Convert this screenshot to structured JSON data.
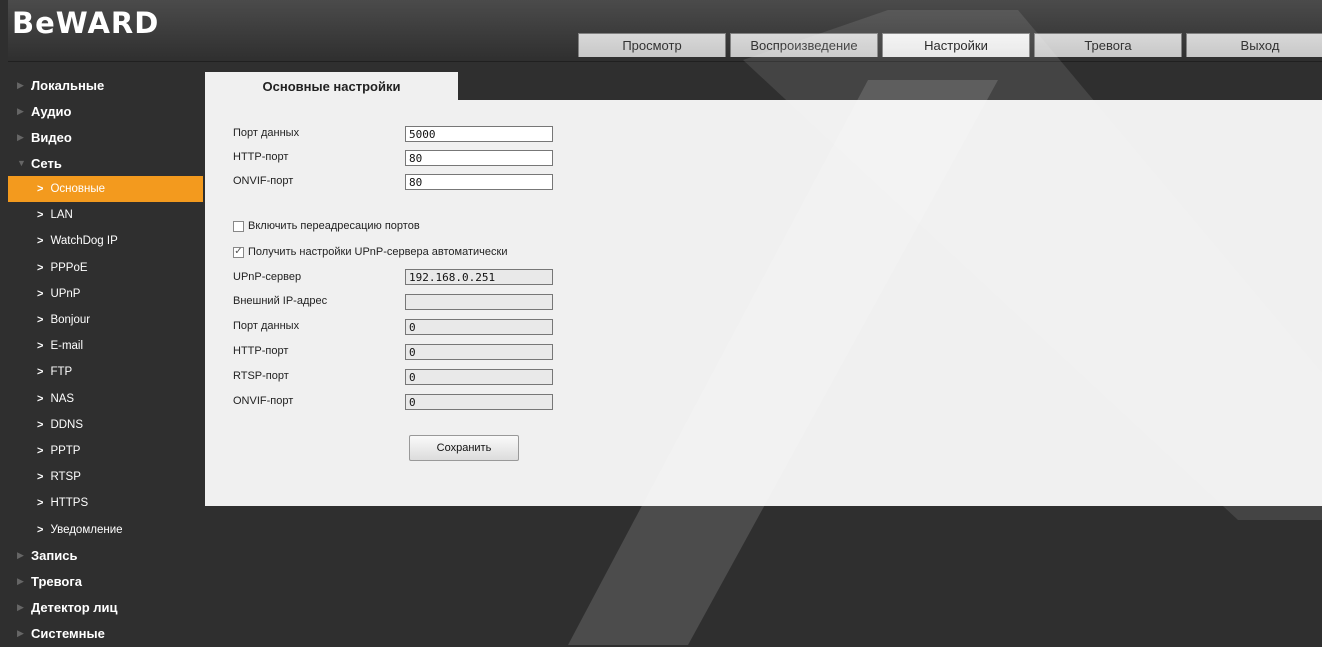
{
  "brand": {
    "logo_text": "BeWARD"
  },
  "nav": {
    "tabs": [
      {
        "label": "Просмотр",
        "active": false
      },
      {
        "label": "Воспроизведение",
        "active": false
      },
      {
        "label": "Настройки",
        "active": true
      },
      {
        "label": "Тревога",
        "active": false
      },
      {
        "label": "Выход",
        "active": false
      }
    ]
  },
  "sidebar": {
    "sections_top": [
      "Локальные",
      "Аудио",
      "Видео",
      "Сеть"
    ],
    "network_items": [
      "Основные",
      "LAN",
      "WatchDog IP",
      "PPPoE",
      "UPnP",
      "Bonjour",
      "E-mail",
      "FTP",
      "NAS",
      "DDNS",
      "PPTP",
      "RTSP",
      "HTTPS",
      "Уведомление"
    ],
    "sections_bottom": [
      "Запись",
      "Тревога",
      "Детектор лиц",
      "Системные"
    ],
    "active_item": "Основные"
  },
  "content": {
    "tab_title": "Основные настройки",
    "fields_top": [
      {
        "label": "Порт данных",
        "value": "5000"
      },
      {
        "label": "HTTP-порт",
        "value": "80"
      },
      {
        "label": "ONVIF-порт",
        "value": "80"
      }
    ],
    "port_forwarding": {
      "label": "Включить переадресацию портов",
      "checked": false
    },
    "upnp_auto": {
      "label": "Получить настройки UPnP-сервера автоматически",
      "checked": true
    },
    "fields_upnp": [
      {
        "label": "UPnP-сервер",
        "value": "192.168.0.251"
      },
      {
        "label": "Внешний IP-адрес",
        "value": ""
      },
      {
        "label": "Порт данных",
        "value": "0"
      },
      {
        "label": "HTTP-порт",
        "value": "0"
      },
      {
        "label": "RTSP-порт",
        "value": "0"
      },
      {
        "label": "ONVIF-порт",
        "value": "0"
      }
    ],
    "save_label": "Сохранить"
  }
}
